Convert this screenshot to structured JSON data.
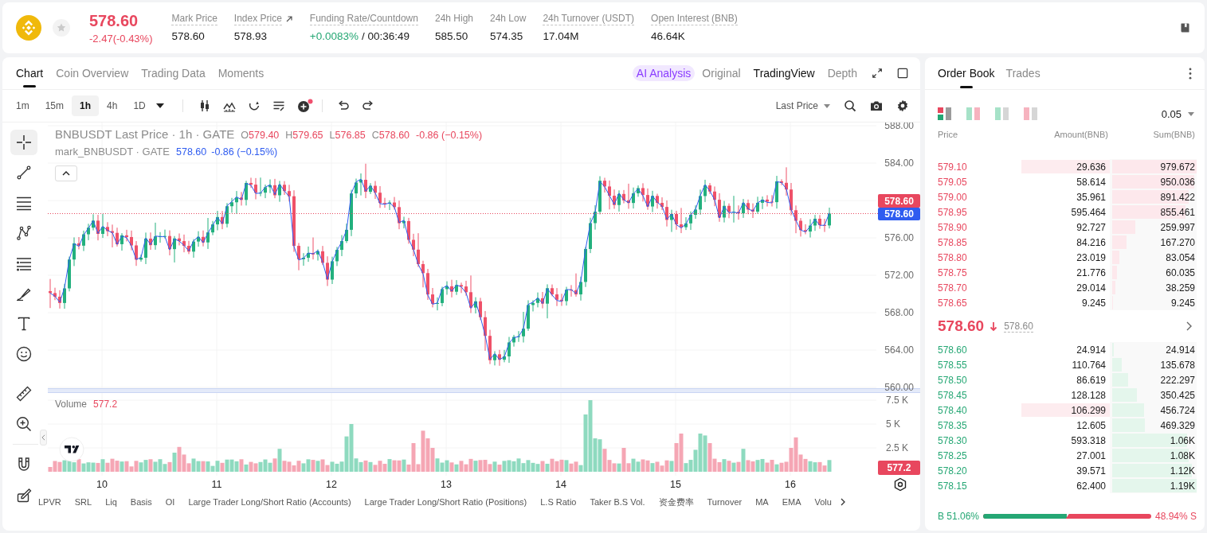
{
  "header": {
    "symbol_price": "578.60",
    "change": "-2.47(-0.43%)",
    "falling": true,
    "favorite": false,
    "stats": [
      {
        "kind": "plain",
        "label": "Mark Price",
        "value": "578.60",
        "tooltip": true,
        "link": false
      },
      {
        "kind": "plain",
        "label": "Index Price",
        "value": "578.93",
        "tooltip": true,
        "link": true
      },
      {
        "kind": "funding",
        "label": "Funding Rate/Countdown",
        "rate": "+0.0083%",
        "countdown": "/ 00:36:49",
        "tooltip": true,
        "link": false
      },
      {
        "kind": "plain",
        "label": "24h High",
        "value": "585.50",
        "tooltip": false,
        "link": false
      },
      {
        "kind": "plain",
        "label": "24h Low",
        "value": "574.35",
        "tooltip": false,
        "link": false
      },
      {
        "kind": "plain",
        "label": "24h Turnover (USDT)",
        "value": "17.04M",
        "tooltip": true,
        "link": false
      },
      {
        "kind": "plain",
        "label": "Open Interest (BNB)",
        "value": "46.64K",
        "tooltip": true,
        "link": false
      }
    ]
  },
  "chart_panel": {
    "tabs": [
      {
        "label": "Chart",
        "selected": true
      },
      {
        "label": "Coin Overview",
        "selected": false
      },
      {
        "label": "Trading Data",
        "selected": false
      },
      {
        "label": "Moments",
        "selected": false
      }
    ],
    "views": [
      {
        "kind": "ai",
        "label": "AI Analysis",
        "selected": false
      },
      {
        "kind": "plain",
        "label": "Original",
        "selected": false
      },
      {
        "kind": "plain",
        "label": "TradingView",
        "selected": true
      },
      {
        "kind": "plain",
        "label": "Depth",
        "selected": false
      }
    ],
    "intervals": [
      {
        "label": "1m",
        "selected": false
      },
      {
        "label": "15m",
        "selected": false
      },
      {
        "label": "1h",
        "selected": true
      },
      {
        "label": "4h",
        "selected": false
      },
      {
        "label": "1D",
        "selected": false
      }
    ],
    "price_source": "Last Price",
    "tool_groups": [
      {
        "tools": [
          {
            "kind": "crosshair",
            "selected": true
          },
          {
            "kind": "trend-line",
            "selected": false
          },
          {
            "kind": "horizontal-lines",
            "selected": false
          },
          {
            "kind": "path",
            "selected": false
          },
          {
            "kind": "levels",
            "selected": false
          },
          {
            "kind": "brush",
            "selected": false
          },
          {
            "kind": "text",
            "selected": false
          },
          {
            "kind": "emoji",
            "selected": false
          }
        ]
      },
      {
        "tools": [
          {
            "kind": "ruler",
            "selected": false
          },
          {
            "kind": "zoom-in",
            "selected": false
          }
        ]
      },
      {
        "tools": [
          {
            "kind": "magnet",
            "selected": false
          },
          {
            "kind": "pencil-lock",
            "selected": false
          }
        ]
      }
    ],
    "legend": {
      "title": "BNBUSDT Last Price · 1h · GATE",
      "ohlc": [
        {
          "key": "O",
          "value": "579.40"
        },
        {
          "key": "H",
          "value": "579.65"
        },
        {
          "key": "L",
          "value": "576.85"
        },
        {
          "key": "C",
          "value": "578.60"
        }
      ],
      "change": "-0.86 (−0.15%)",
      "mark_title": "mark_BNBUSDT · GATE",
      "mark_price": "578.60",
      "mark_change": "-0.86 (−0.15%)"
    },
    "price_axis": [
      "588.00",
      "584.00",
      "576.00",
      "572.00",
      "568.00",
      "564.00",
      "560.00"
    ],
    "last_price_tag": "578.60",
    "mark_price_tag": "578.60",
    "volume": {
      "label": "Volume",
      "value": "577.2",
      "axis": [
        "7.5 K",
        "5 K",
        "2.5 K"
      ],
      "tag": "577.2"
    },
    "time_axis": [
      "10",
      "11",
      "12",
      "13",
      "14",
      "15",
      "16"
    ],
    "indicators": [
      "LPVR",
      "SRL",
      "Liq",
      "Basis",
      "OI",
      "Large Trader Long/Short Ratio (Accounts)",
      "Large Trader Long/Short Ratio (Positions)",
      "L.S Ratio",
      "Taker B.S Vol.",
      "资金费率",
      "Turnover",
      "MA",
      "EMA",
      "Volu"
    ]
  },
  "order_book": {
    "tabs": [
      {
        "label": "Order Book",
        "selected": true
      },
      {
        "label": "Trades",
        "selected": false
      }
    ],
    "modes": [
      {
        "kind": "both",
        "selected": true
      },
      {
        "kind": "side-by-side",
        "selected": false
      },
      {
        "kind": "bids",
        "selected": false
      },
      {
        "kind": "asks",
        "selected": false
      }
    ],
    "precision": "0.05",
    "columns": [
      "Price",
      "Amount(BNB)",
      "Sum(BNB)"
    ],
    "asks": [
      {
        "price": "579.10",
        "amount": "29.636",
        "sum": "979.672",
        "level": 1.0,
        "highlight": true
      },
      {
        "price": "579.05",
        "amount": "58.614",
        "sum": "950.036",
        "level": 0.97,
        "highlight": false
      },
      {
        "price": "579.00",
        "amount": "35.961",
        "sum": "891.422",
        "level": 0.91,
        "highlight": false
      },
      {
        "price": "578.95",
        "amount": "595.464",
        "sum": "855.461",
        "level": 0.87,
        "highlight": false
      },
      {
        "price": "578.90",
        "amount": "92.727",
        "sum": "259.997",
        "level": 0.27,
        "highlight": false
      },
      {
        "price": "578.85",
        "amount": "84.216",
        "sum": "167.270",
        "level": 0.17,
        "highlight": false
      },
      {
        "price": "578.80",
        "amount": "23.019",
        "sum": "83.054",
        "level": 0.085,
        "highlight": false
      },
      {
        "price": "578.75",
        "amount": "21.776",
        "sum": "60.035",
        "level": 0.06,
        "highlight": false
      },
      {
        "price": "578.70",
        "amount": "29.014",
        "sum": "38.259",
        "level": 0.04,
        "highlight": false
      },
      {
        "price": "578.65",
        "amount": "9.245",
        "sum": "9.245",
        "level": 0.01,
        "highlight": false
      }
    ],
    "mid": {
      "price": "578.60",
      "falling": true,
      "mark": "578.60"
    },
    "bids": [
      {
        "price": "578.60",
        "amount": "24.914",
        "sum": "24.914",
        "level": 0.02,
        "highlight": false
      },
      {
        "price": "578.55",
        "amount": "110.764",
        "sum": "135.678",
        "level": 0.11,
        "highlight": false
      },
      {
        "price": "578.50",
        "amount": "86.619",
        "sum": "222.297",
        "level": 0.19,
        "highlight": false
      },
      {
        "price": "578.45",
        "amount": "128.128",
        "sum": "350.425",
        "level": 0.29,
        "highlight": false
      },
      {
        "price": "578.40",
        "amount": "106.299",
        "sum": "456.724",
        "level": 0.38,
        "highlight": true
      },
      {
        "price": "578.35",
        "amount": "12.605",
        "sum": "469.329",
        "level": 0.39,
        "highlight": false
      },
      {
        "price": "578.30",
        "amount": "593.318",
        "sum": "1.06K",
        "level": 0.89,
        "highlight": false
      },
      {
        "price": "578.25",
        "amount": "27.001",
        "sum": "1.08K",
        "level": 0.91,
        "highlight": false
      },
      {
        "price": "578.20",
        "amount": "39.571",
        "sum": "1.12K",
        "level": 0.94,
        "highlight": false
      },
      {
        "price": "578.15",
        "amount": "62.400",
        "sum": "1.19K",
        "level": 1.0,
        "highlight": false
      }
    ],
    "ratio": {
      "buy": "B 51.06%",
      "sell": "48.94% S",
      "level": 0.5106
    }
  }
}
